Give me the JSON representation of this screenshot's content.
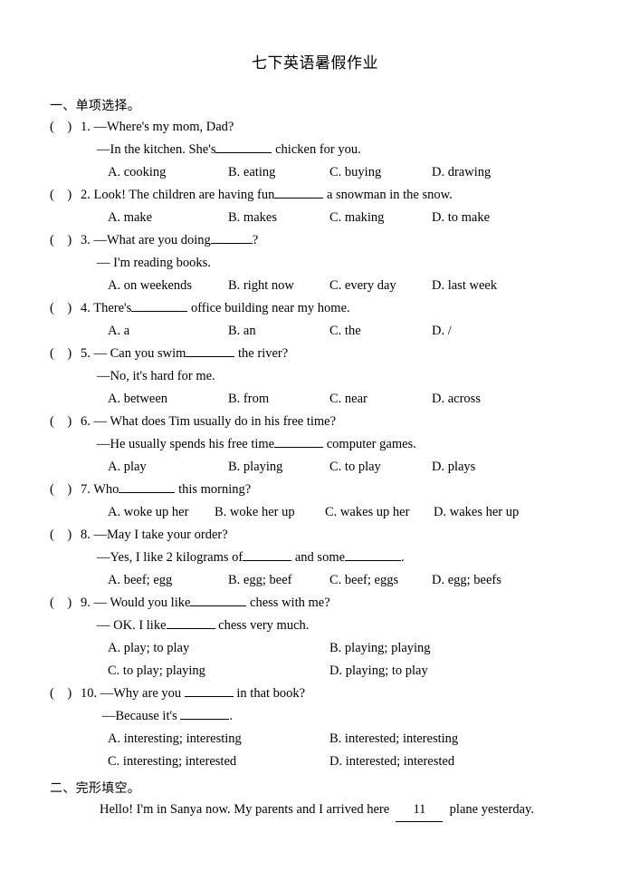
{
  "document": {
    "title": "七下英语暑假作业"
  },
  "sections": [
    {
      "heading": "一、单项选择。",
      "questions": [
        {
          "paren": "(    )",
          "number": "1.",
          "stem": " —Where's my mom, Dad?",
          "stem2_pre": "—In the kitchen. She's",
          "stem2_post": " chicken for you.",
          "options": [
            "A. cooking",
            "B. eating",
            "C. buying",
            "D. drawing"
          ]
        },
        {
          "paren": "(    )",
          "number": "2.",
          "stem_pre": " Look! The children are having fun",
          "stem_post": " a snowman in the snow.",
          "options": [
            "A. make",
            "B. makes",
            "C. making",
            "D. to make"
          ]
        },
        {
          "paren": "(    )",
          "number": "3.",
          "stem_pre": " —What are you doing",
          "stem_post": "?",
          "stem2": "— I'm reading books.",
          "options": [
            "A. on weekends",
            "B. right now",
            "C. every day",
            "D. last week"
          ]
        },
        {
          "paren": "(    )",
          "number": "4.",
          "stem_pre": " There's",
          "stem_post": " office building near my home.",
          "options": [
            "A. a",
            "B. an",
            "C. the",
            "D. /"
          ]
        },
        {
          "paren": "(    )",
          "number": "5.",
          "stem_pre": " — Can you swim",
          "stem_post": " the river?",
          "stem2": "—No, it's hard for me.",
          "options": [
            "A. between",
            "B. from",
            "C. near",
            "D. across"
          ]
        },
        {
          "paren": "(    )",
          "number": "6.",
          "stem": " — What does Tim usually do in his free time?",
          "stem2_pre": "—He usually spends his free time",
          "stem2_post": " computer games.",
          "options": [
            "A. play",
            "B. playing",
            "C. to play",
            "D. plays"
          ]
        },
        {
          "paren": "(    )",
          "number": "7.",
          "stem_pre": " Who",
          "stem_post": " this morning?",
          "options": [
            "A. woke up her",
            "B. woke her up",
            "C. wakes up her",
            "D. wakes her up"
          ]
        },
        {
          "paren": "(    )",
          "number": "8.",
          "stem": " —May I take your order?",
          "stem2_pre": "—Yes, I like 2 kilograms of",
          "stem2_mid": " and some",
          "stem2_post": ".",
          "options": [
            "A. beef; egg",
            "B. egg; beef",
            "C. beef; eggs",
            "D. egg; beefs"
          ]
        },
        {
          "paren": "(    )",
          "number": "9.",
          "stem_pre": " — Would you like",
          "stem_post": " chess with me?",
          "stem2_pre": "— OK. I like",
          "stem2_post": " chess very much.",
          "options": [
            "A. play; to play",
            "B. playing; playing",
            "C. to play; playing",
            "D. playing; to play"
          ]
        },
        {
          "paren": "(    )",
          "number": "10.",
          "stem_pre": " —Why are you ",
          "stem_post": " in that book?",
          "stem2_pre": "—Because it's ",
          "stem2_post": ".",
          "options": [
            "A. interesting; interesting",
            "B. interested; interesting",
            "C. interesting; interested",
            "D. interested; interested"
          ]
        }
      ]
    },
    {
      "heading": "二、完形填空。",
      "passage_pre": "Hello! I'm in Sanya now. My parents and I arrived here  ",
      "passage_blank": "11",
      "passage_post": "  plane yesterday."
    }
  ]
}
